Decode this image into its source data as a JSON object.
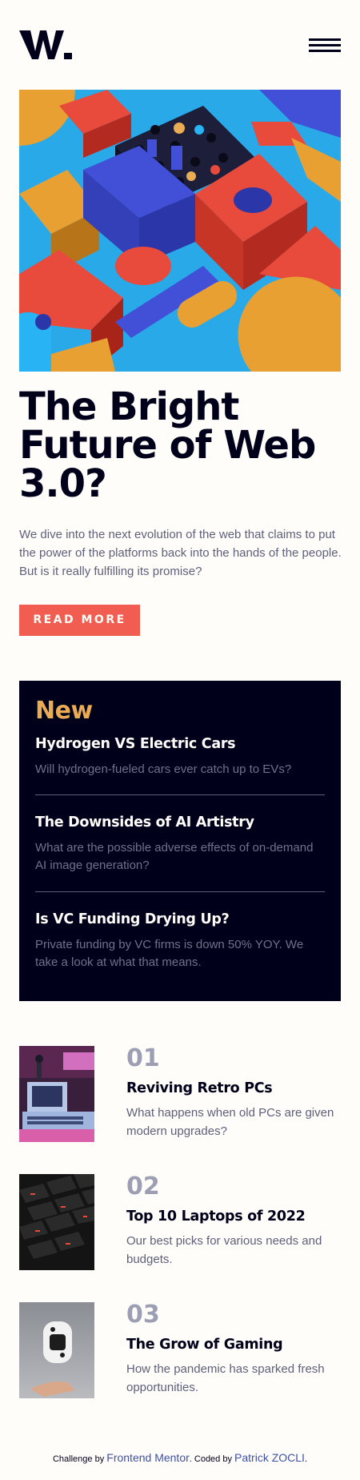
{
  "header": {
    "logo_text": "W.",
    "menu_icon": "hamburger-menu-icon"
  },
  "hero": {
    "image_alt": "Abstract 3D colorful geometric blocks",
    "title": "The Bright Future of Web 3.0?",
    "description": "We dive into the next evolution of the web that claims to put the power of the platforms back into the hands of the people. But is it really fulfilling its promise?",
    "button_label": "READ MORE"
  },
  "new_section": {
    "heading": "New",
    "items": [
      {
        "title": "Hydrogen VS Electric Cars",
        "text": "Will hydrogen-fueled cars ever catch up to EVs?"
      },
      {
        "title": "The Downsides of AI Artistry",
        "text": "What are the possible adverse effects of on-demand AI image generation?"
      },
      {
        "title": "Is VC Funding Drying Up?",
        "text": "Private funding by VC firms is down 50% YOY. We take a look at what that means."
      }
    ]
  },
  "numbered": [
    {
      "number": "01",
      "title": "Reviving Retro PCs",
      "text": "What happens when old PCs are given modern upgrades?"
    },
    {
      "number": "02",
      "title": "Top 10 Laptops of 2022",
      "text": "Our best picks for various needs and budgets."
    },
    {
      "number": "03",
      "title": "The Grow of Gaming",
      "text": "How the pandemic has sparked fresh opportunities."
    }
  ],
  "footer": {
    "prefix": "Challenge by",
    "link1": "Frontend Mentor",
    "middle": ". Coded by",
    "link2": "Patrick ZOCLI",
    "suffix": "."
  },
  "colors": {
    "accent_red": "#f15d51",
    "accent_orange": "#e9ab53",
    "dark_navy": "#00001a",
    "off_white": "#fffdfa",
    "grayish_blue": "#5e607a"
  }
}
